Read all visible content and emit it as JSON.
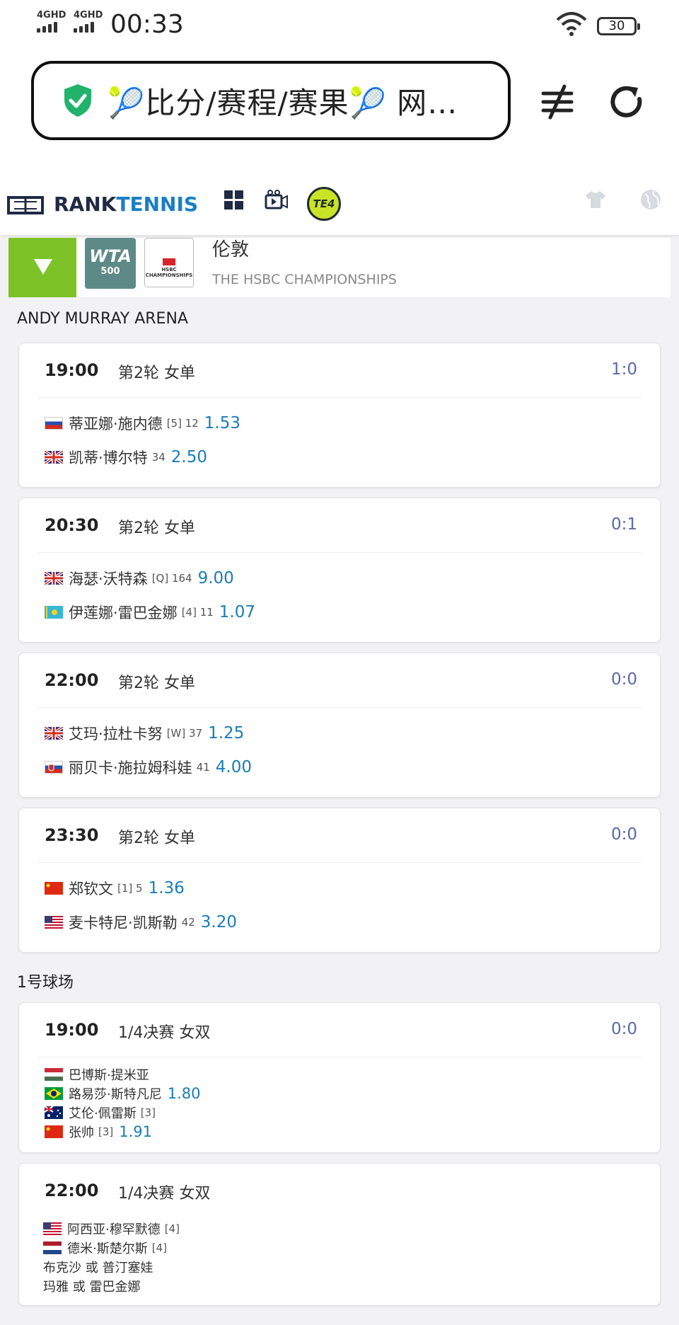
{
  "status_bar": {
    "signal1": "4GHD",
    "signal2": "4GHD",
    "time": "00:33",
    "battery": "30"
  },
  "browser": {
    "url_text": "🎾比分/赛程/赛果🎾 网…"
  },
  "site": {
    "logo_rank": "RANK",
    "logo_tennis": "TENNIS",
    "te4_label": "TE4"
  },
  "tournament": {
    "badge_top": "WTA",
    "badge_bottom": "500",
    "sponsor": "HSBC CHAMPIONSHIPS",
    "name": "伦敦",
    "subtitle": "THE HSBC CHAMPIONSHIPS"
  },
  "venues": [
    {
      "name": "ANDY MURRAY ARENA",
      "matches": [
        {
          "time": "19:00",
          "round": "第2轮 女单",
          "score": "1:0",
          "players": [
            {
              "flag": "russia",
              "name": "蒂亚娜·施内德",
              "tag": "[5] 12",
              "odds": "1.53"
            },
            {
              "flag": "uk",
              "name": "凯蒂·博尔特",
              "tag": "34",
              "odds": "2.50"
            }
          ]
        },
        {
          "time": "20:30",
          "round": "第2轮 女单",
          "score": "0:1",
          "players": [
            {
              "flag": "uk",
              "name": "海瑟·沃特森",
              "tag": "[Q] 164",
              "odds": "9.00"
            },
            {
              "flag": "kazakhstan",
              "name": "伊莲娜·雷巴金娜",
              "tag": "[4] 11",
              "odds": "1.07"
            }
          ]
        },
        {
          "time": "22:00",
          "round": "第2轮 女单",
          "score": "0:0",
          "players": [
            {
              "flag": "uk",
              "name": "艾玛·拉杜卡努",
              "tag": "[W] 37",
              "odds": "1.25"
            },
            {
              "flag": "slovakia",
              "name": "丽贝卡·施拉姆科娃",
              "tag": "41",
              "odds": "4.00"
            }
          ]
        },
        {
          "time": "23:30",
          "round": "第2轮 女单",
          "score": "0:0",
          "players": [
            {
              "flag": "china",
              "name": "郑钦文",
              "tag": "[1] 5",
              "odds": "1.36"
            },
            {
              "flag": "usa",
              "name": "麦卡特尼·凯斯勒",
              "tag": "42",
              "odds": "3.20"
            }
          ]
        }
      ]
    },
    {
      "name": "1号球场",
      "matches": [
        {
          "time": "19:00",
          "round": "1/4决赛 女双",
          "score": "0:0",
          "players": [
            {
              "flag": "hungary",
              "name": "巴博斯·提米亚",
              "tag": "",
              "odds": ""
            },
            {
              "flag": "brazil",
              "name": "路易莎·斯特凡尼",
              "tag": "",
              "odds": "1.80"
            },
            {
              "flag": "australia",
              "name": "艾伦·佩雷斯",
              "tag": "[3]",
              "odds": ""
            },
            {
              "flag": "china",
              "name": "张帅",
              "tag": "[3]",
              "odds": "1.91"
            }
          ]
        },
        {
          "time": "22:00",
          "round": "1/4决赛 女双",
          "score": "",
          "players": [
            {
              "flag": "usa",
              "name": "阿西亚·穆罕默德",
              "tag": "[4]",
              "odds": ""
            },
            {
              "flag": "netherlands",
              "name": "德米·斯楚尔斯",
              "tag": "[4]",
              "odds": ""
            },
            {
              "flag": "",
              "name": "布克沙 或 普汀塞娃",
              "tag": "",
              "odds": ""
            },
            {
              "flag": "",
              "name": "玛雅 或 雷巴金娜",
              "tag": "",
              "odds": ""
            }
          ]
        }
      ]
    }
  ],
  "colors": {
    "accent_green": "#7dc327",
    "odds_blue": "#1a7cb8",
    "score_purple": "#5a6aa8",
    "brand_blue": "#1a7fc4"
  }
}
